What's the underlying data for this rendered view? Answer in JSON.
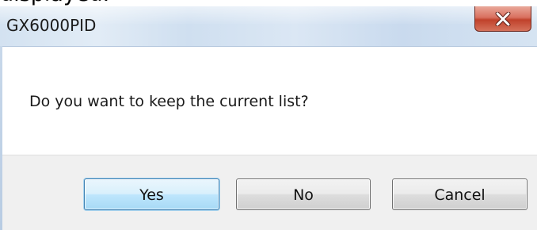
{
  "context": {
    "cropped_text": "displayed."
  },
  "dialog": {
    "title": "GX6000PID",
    "close_icon": "close-x-icon",
    "message": "Do you want to keep the current list?",
    "buttons": {
      "yes": "Yes",
      "no": "No",
      "cancel": "Cancel"
    },
    "colors": {
      "close_button": "#c94a35",
      "default_button_border": "#3c7fb1",
      "panel_background": "#f0f0f0"
    }
  }
}
